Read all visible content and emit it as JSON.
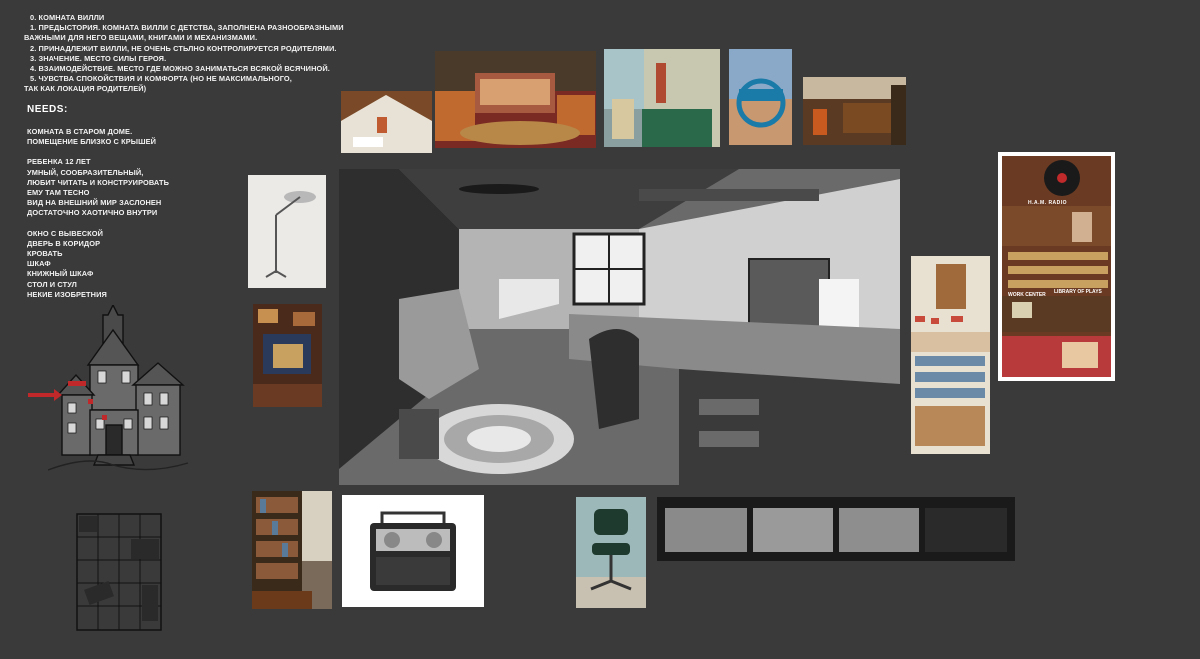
{
  "story": {
    "lines": [
      "0. КОМНАТА ВИЛЛИ",
      "1. ПРЕДЫСТОРИЯ. КОМНАТА ВИЛЛИ С ДЕТСТВА, ЗАПОЛНЕНА РАЗНООБРАЗНЫМИ",
      "ВАЖНЫМИ ДЛЯ НЕГО ВЕЩАМИ, КНИГАМИ И МЕХАНИЗМАМИ.",
      "2. ПРИНАДЛЕЖИТ ВИЛЛИ, НЕ ОЧЕНЬ СТЬЛНО КОНТРОЛИРУЕТСЯ РОДИТЕЛЯМИ.",
      "3. ЗНАЧЕНИЕ. МЕСТО СИЛЫ ГЕРОЯ.",
      "4. ВЗАИМОДЕЙСТВИЕ. МЕСТО ГДЕ МОЖНО ЗАНИМАТЬСЯ ВСЯКОЙ ВСЯЧИНОЙ.",
      "5. ЧУВСТВА СПОКОЙСТВИЯ И КОМФОРТА (НО НЕ МАКСИМАЛЬНОГО,",
      "ТАК КАК ЛОКАЦИЯ РОДИТЕЛЕЙ)"
    ]
  },
  "needs": {
    "title": "NEEDS:",
    "group1": [
      "КОМНАТА В СТАРОМ ДОМЕ.",
      "ПОМЕЩЕНИЕ БЛИЗКО С КРЫШЕЙ"
    ],
    "group2": [
      "РЕБЕНКА 12 ЛЕТ",
      "УМНЫЙ, СООБРАЗИТЕЛЬНЫЙ,",
      "ЛЮБИТ ЧИТАТЬ И КОНСТРУИРОВАТЬ",
      "ЕМУ ТАМ ТЕСНО",
      "ВИД НА ВНЕШНИЙ МИР ЗАСЛОНЕН",
      "ДОСТАТОЧНО ХАОТИЧНО ВНУТРИ"
    ],
    "group3": [
      "ОКНО С ВЫВЕСКОЙ",
      "ДВЕРЬ В КОРИДОР",
      "КРОВАТЬ",
      "ШКАФ",
      "КНИЖНЫЙ ШКАФ",
      "СТОЛ И СТУЛ",
      "НЕКИЕ ИЗОБРЕТНИЯ"
    ]
  },
  "poster": {
    "labels": [
      "H.A.M. RADIO",
      "LIBRARY OF PLAYS",
      "WORK CENTER"
    ]
  },
  "colors": {
    "background": "#3a3a3a",
    "text": "#f2f2f2",
    "accent_red": "#c0282a"
  }
}
